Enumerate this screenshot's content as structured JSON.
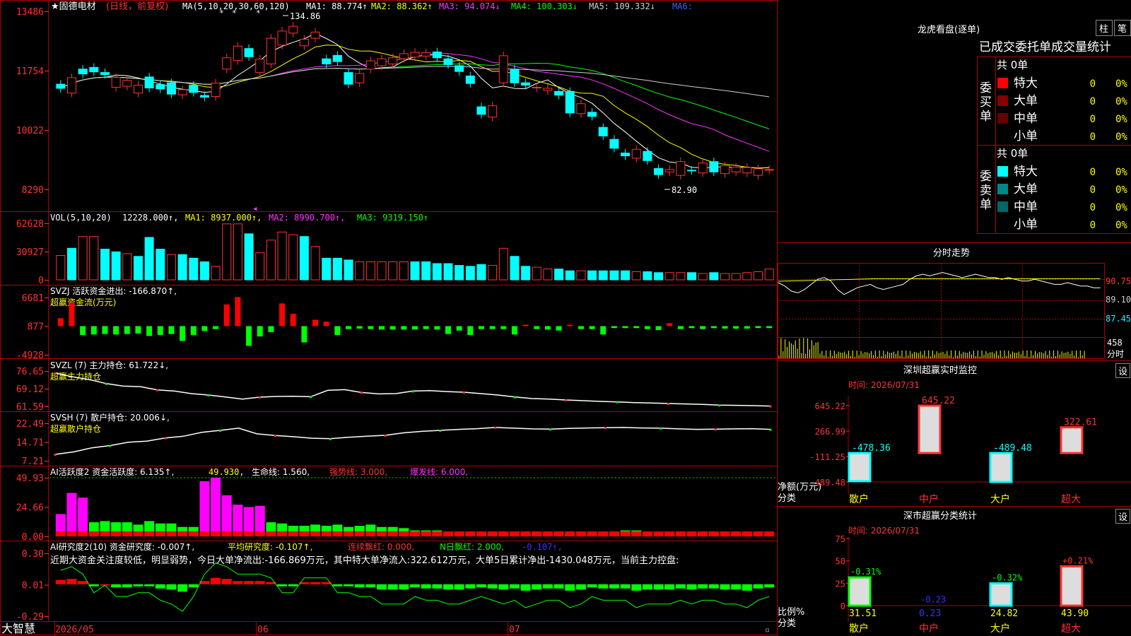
{
  "header": {
    "stock_name": "★固德电材",
    "period": "(日线，前复权)",
    "ma_label": "MA(5,10,20,30,60,120)",
    "ma": [
      {
        "label": "MA1: 88.774↑",
        "color": "#ffffff"
      },
      {
        "label": "MA2: 88.362↑",
        "color": "#ffff00"
      },
      {
        "label": "MA3: 94.074↓",
        "color": "#ff33ff"
      },
      {
        "label": "MA4: 100.303↓",
        "color": "#00ff00"
      },
      {
        "label": "MA5: 109.332↓",
        "color": "#d0d0d0"
      },
      {
        "label": "MA6:",
        "color": "#3366ff"
      }
    ],
    "high_note": "134.86",
    "low_note": "82.90"
  },
  "axes": {
    "price_ticks": [
      "13486",
      "11754",
      "10022",
      "8290"
    ],
    "vol_ticks": [
      "62628",
      "30927",
      "0"
    ],
    "svzj_ticks": [
      "6681",
      "877",
      "-4928"
    ],
    "svzl_ticks": [
      "76.65",
      "69.12",
      "61.59"
    ],
    "svsh_ticks": [
      "22.49",
      "14.71",
      "7.21"
    ],
    "ai_ticks": [
      "49.93",
      "24.66",
      "0.00"
    ],
    "ai2_ticks": [
      "0.30",
      "0.01",
      "-0.29"
    ],
    "dates": [
      "2026/05",
      "06",
      "07"
    ]
  },
  "panels": {
    "vol": {
      "title": "VOL(5,10,20)",
      "value": "12228.000↑,",
      "ma1": "MA1: 8937.000↑,",
      "ma2": "MA2: 8990.700↑,",
      "ma3": "MA3: 9319.150↑"
    },
    "svzj": {
      "title": "SVZJ  活跃资金进出: -166.870↑,",
      "subtitle": "超赢资金流(万元)"
    },
    "svzl": {
      "title": "SVZL (7) 主力持仓: 61.722↓,",
      "subtitle": "超赢主力持仓"
    },
    "svsh": {
      "title": "SVSH (7) 散户持仓: 20.006↓,",
      "subtitle": "超赢散户持仓"
    },
    "ai": {
      "title": "AI活跃度2 资金活跃度: 6.135↑,",
      "v2": "49.930,",
      "v3": "生命线: 1.560,",
      "v4": "强势线: 3.000,",
      "v5": "爆发线: 6.000,"
    },
    "ai2": {
      "title": "AI研究度2(10) 资金研究度: -0.007↑,",
      "v2": "平均研究度: -0.107↑,",
      "v3": "连续飘红: 0.000,",
      "v4": "N日飘红: 2.000,",
      "v5": "-0.107↑,",
      "comment": "近期大资金关注度较低，明显弱势，今日大单净流出:-166.869万元，其中特大单净流入:322.612万元，大单5日累计净出-1430.048万元，当前主力控盘:"
    }
  },
  "brand": "大智慧",
  "right": {
    "dragon": {
      "title": "龙虎看盘(逐单)",
      "btn1": "柱",
      "btn2": "笔",
      "subtitle": "已成交委托单成交量统计",
      "buy": {
        "side": "委买单",
        "count": "共 0单",
        "rows": [
          {
            "label": "特大",
            "value": "0",
            "pct": "0%"
          },
          {
            "label": "大单",
            "value": "0",
            "pct": "0%"
          },
          {
            "label": "中单",
            "value": "0",
            "pct": "0%"
          },
          {
            "label": "小单",
            "value": "0",
            "pct": "0%"
          }
        ]
      },
      "sell": {
        "side": "委卖单",
        "count": "共 0单",
        "rows": [
          {
            "label": "特大",
            "value": "0",
            "pct": "0%"
          },
          {
            "label": "大单",
            "value": "0",
            "pct": "0%"
          },
          {
            "label": "中单",
            "value": "0",
            "pct": "0%"
          },
          {
            "label": "小单",
            "value": "0",
            "pct": "0%"
          }
        ]
      }
    },
    "intraday": {
      "title": "分时走势",
      "p1": "90.75",
      "p2": "89.10",
      "p3": "87.45",
      "vol": "458",
      "unit": "分时"
    },
    "monitor": {
      "title": "深圳超赢实时监控",
      "btn": "设",
      "time": "时间: 2026/07/31",
      "ticks": [
        "645.22",
        "266.99",
        "-111.25",
        "-489.48"
      ],
      "ylabel1": "净额(万元)",
      "ylabel2": "分类",
      "cats": [
        "散户",
        "中户",
        "大户",
        "超大"
      ]
    },
    "stats": {
      "title": "深市超赢分类统计",
      "btn": "设",
      "time": "时间: 2026/07/31",
      "ticks": [
        "75",
        "50",
        "25",
        "0"
      ],
      "ylabel1": "比例%",
      "ylabel2": "分类",
      "cats": [
        "散户",
        "中户",
        "大户",
        "超大"
      ]
    }
  },
  "chart_data": [
    {
      "type": "candlestick",
      "title": "★固德电材 (日线，前复权)",
      "ylim": [
        82.9,
        134.86
      ],
      "ticks": [
        134.86,
        117.54,
        100.22,
        82.9
      ],
      "x": [
        "2026/05",
        "06",
        "07"
      ],
      "candles": [
        {
          "o": 113.6,
          "c": 112.4
        },
        {
          "o": 111.0,
          "c": 115.5
        },
        {
          "o": 118.0,
          "c": 116.6
        },
        {
          "o": 118.5,
          "c": 117.2
        },
        {
          "o": 117.0,
          "c": 116.4
        },
        {
          "o": 112.7,
          "c": 115.6
        },
        {
          "o": 113.0,
          "c": 114.7
        },
        {
          "o": 111.0,
          "c": 113.3
        },
        {
          "o": 115.7,
          "c": 112.5
        },
        {
          "o": 113.5,
          "c": 112.2
        },
        {
          "o": 114.0,
          "c": 110.7
        },
        {
          "o": 110.5,
          "c": 112.0
        },
        {
          "o": 113.3,
          "c": 111.2
        },
        {
          "o": 110.3,
          "c": 109.8
        },
        {
          "o": 110.0,
          "c": 113.9
        },
        {
          "o": 118.0,
          "c": 121.3
        },
        {
          "o": 120.5,
          "c": 124.7
        },
        {
          "o": 124.0,
          "c": 121.6
        },
        {
          "o": 117.0,
          "c": 120.9
        },
        {
          "o": 119.5,
          "c": 127.0
        },
        {
          "o": 125.0,
          "c": 129.1
        },
        {
          "o": 128.5,
          "c": 130.5
        },
        {
          "o": 124.8,
          "c": 126.7
        },
        {
          "o": 127.0,
          "c": 128.8
        },
        {
          "o": 121.0,
          "c": 119.5
        },
        {
          "o": 122.0,
          "c": 120.2
        },
        {
          "o": 117.0,
          "c": 113.6
        },
        {
          "o": 114.0,
          "c": 116.7
        },
        {
          "o": 118.0,
          "c": 120.4
        },
        {
          "o": 119.0,
          "c": 121.0
        },
        {
          "o": 119.5,
          "c": 121.3
        },
        {
          "o": 121.0,
          "c": 122.5
        },
        {
          "o": 121.5,
          "c": 122.9
        },
        {
          "o": 121.8,
          "c": 122.8
        },
        {
          "o": 123.0,
          "c": 121.3
        },
        {
          "o": 121.0,
          "c": 119.3
        },
        {
          "o": 119.0,
          "c": 117.3
        },
        {
          "o": 116.0,
          "c": 113.8
        },
        {
          "o": 107.0,
          "c": 104.8
        },
        {
          "o": 104.0,
          "c": 107.3
        },
        {
          "o": 114.0,
          "c": 121.9
        },
        {
          "o": 118.0,
          "c": 114.0
        },
        {
          "o": 114.0,
          "c": 113.3
        },
        {
          "o": 112.5,
          "c": 112.7
        },
        {
          "o": 111.8,
          "c": 112.4
        },
        {
          "o": 111.5,
          "c": 110.4
        },
        {
          "o": 111.5,
          "c": 105.2
        },
        {
          "o": 105.0,
          "c": 107.9
        },
        {
          "o": 105.4,
          "c": 104.2
        },
        {
          "o": 101.0,
          "c": 98.5
        },
        {
          "o": 97.5,
          "c": 94.9
        },
        {
          "o": 93.5,
          "c": 92.7
        },
        {
          "o": 92.0,
          "c": 94.6
        },
        {
          "o": 94.0,
          "c": 91.3
        },
        {
          "o": 89.0,
          "c": 87.2
        },
        {
          "o": 88.0,
          "c": 88.7
        },
        {
          "o": 87.0,
          "c": 91.0
        },
        {
          "o": 88.5,
          "c": 88.4
        },
        {
          "o": 87.7,
          "c": 90.6
        },
        {
          "o": 91.0,
          "c": 88.0
        },
        {
          "o": 87.5,
          "c": 89.8
        },
        {
          "o": 88.0,
          "c": 89.4
        },
        {
          "o": 87.7,
          "c": 89.3
        },
        {
          "o": 87.0,
          "c": 88.9
        },
        {
          "o": 88.5,
          "c": 88.7
        }
      ]
    },
    {
      "type": "bar",
      "title": "VOL(5,10,20)",
      "ylim": [
        0,
        62628
      ],
      "values": [
        27000,
        35000,
        48000,
        48000,
        34000,
        31000,
        29000,
        26000,
        47000,
        34000,
        28000,
        28000,
        24000,
        20000,
        15000,
        62000,
        62000,
        51000,
        30000,
        44000,
        53000,
        50000,
        48000,
        37000,
        24000,
        24000,
        22000,
        20000,
        20000,
        20000,
        20000,
        20000,
        20000,
        20000,
        18000,
        18000,
        16000,
        15000,
        17000,
        16000,
        35000,
        26000,
        15000,
        14000,
        12000,
        12000,
        10000,
        10000,
        10000,
        10000,
        10000,
        10000,
        9000,
        9000,
        8000,
        8000,
        8000,
        8000,
        7000,
        8000,
        7000,
        7000,
        8000,
        9000,
        12000
      ],
      "up": [
        1,
        0,
        1,
        1,
        0,
        0,
        1,
        0,
        0,
        0,
        1,
        0,
        0,
        0,
        1,
        1,
        1,
        0,
        1,
        1,
        1,
        1,
        0,
        1,
        0,
        0,
        0,
        1,
        1,
        1,
        1,
        1,
        0,
        0,
        0,
        0,
        0,
        0,
        0,
        1,
        1,
        0,
        0,
        1,
        1,
        0,
        0,
        1,
        0,
        0,
        0,
        0,
        1,
        0,
        0,
        1,
        1,
        0,
        1,
        0,
        1,
        1,
        1,
        1,
        1
      ]
    },
    {
      "type": "bar",
      "title": "SVZJ",
      "ylim": [
        -4928,
        6681
      ],
      "values": [
        1600,
        4800,
        -1800,
        -1700,
        -1600,
        -1700,
        -1600,
        -1500,
        -2000,
        -1800,
        -1600,
        -3000,
        -1800,
        -1000,
        -600,
        4400,
        5900,
        -4000,
        -2100,
        -1200,
        4600,
        2500,
        -3300,
        1300,
        900,
        -1800,
        -600,
        -500,
        -600,
        -700,
        -700,
        -700,
        -700,
        -600,
        -700,
        -1600,
        -900,
        -1800,
        -600,
        -600,
        -600,
        -1700,
        300,
        -600,
        -700,
        -900,
        300,
        -600,
        -600,
        -1700,
        -400,
        -400,
        -400,
        -600,
        -800,
        600,
        -600,
        -400,
        -600,
        -400,
        -500,
        -500,
        -500,
        -400,
        -400
      ]
    },
    {
      "type": "line",
      "title": "SVZL (7)",
      "ylim": [
        61.59,
        76.65
      ],
      "values": [
        75.8,
        74.2,
        73.0,
        71.3,
        70.2,
        70.0,
        68.6,
        68.1,
        67.0,
        66.4,
        65.6,
        64.7,
        65.5,
        65.8,
        65.9,
        65.7,
        68.4,
        68.7,
        67.5,
        66.9,
        67.0,
        68.1,
        68.3,
        67.9,
        67.6,
        67.0,
        66.4,
        65.6,
        64.9,
        64.7,
        64.3,
        64.0,
        63.7,
        63.5,
        63.2,
        63.0,
        62.8,
        62.6,
        62.4,
        62.1,
        62.0,
        61.9,
        61.72
      ]
    },
    {
      "type": "line",
      "title": "SVSH (7)",
      "ylim": [
        7.21,
        22.49
      ],
      "values": [
        9.8,
        10.8,
        12.5,
        13.4,
        14.8,
        15.2,
        16.5,
        17.2,
        18.8,
        19.6,
        20.5,
        18.2,
        17.5,
        17.0,
        16.4,
        16.2,
        16.8,
        17.2,
        17.6,
        18.6,
        19.2,
        19.6,
        20.0,
        20.3,
        20.8,
        20.5,
        20.2,
        20.1,
        20.4,
        20.6,
        20.7,
        20.8,
        20.6,
        20.5,
        20.2,
        20.0,
        20.1,
        20.2,
        20.3,
        20.006
      ]
    },
    {
      "type": "bar",
      "title": "AI活跃度2",
      "ylim": [
        0,
        49.93
      ],
      "values": [
        19,
        37,
        33,
        12,
        13,
        12,
        12,
        10,
        13,
        11,
        11,
        8,
        8,
        47,
        50,
        35,
        27,
        25,
        26,
        12,
        11,
        9,
        9,
        10,
        9,
        10,
        8,
        9,
        10,
        8,
        8,
        7,
        5,
        5,
        5,
        4,
        4,
        4,
        4,
        3,
        3,
        4,
        3,
        4,
        3,
        3,
        2,
        2,
        3,
        3,
        4,
        5,
        5,
        4,
        4,
        4,
        3,
        3,
        3,
        3,
        3,
        3,
        3,
        3,
        3
      ],
      "magenta": [
        1,
        1,
        1,
        0,
        0,
        0,
        0,
        0,
        0,
        0,
        0,
        0,
        0,
        1,
        1,
        1,
        1,
        1,
        1,
        0,
        0,
        0,
        0,
        0,
        0,
        0,
        0,
        0,
        0,
        0,
        0,
        0,
        0,
        0,
        0,
        0,
        0,
        0,
        0,
        0,
        0,
        0,
        0,
        0,
        0,
        0,
        0,
        0,
        0,
        0,
        0,
        0,
        0,
        0,
        0,
        0,
        0,
        0,
        0,
        0,
        0,
        0,
        0,
        0,
        0
      ]
    },
    {
      "type": "bar",
      "title": "AI研究度2(10)",
      "ylim": [
        -0.29,
        0.3
      ],
      "values": [
        0.04,
        0.05,
        0.03,
        -0.02,
        0.0,
        -0.03,
        -0.03,
        -0.02,
        -0.02,
        -0.04,
        -0.05,
        -0.07,
        -0.03,
        0.03,
        0.06,
        0.05,
        0.03,
        0.03,
        0.03,
        0.02,
        -0.02,
        -0.02,
        0.02,
        0.02,
        0.02,
        -0.02,
        -0.02,
        -0.03,
        -0.03,
        -0.05,
        -0.05,
        -0.05,
        -0.03,
        -0.04,
        -0.04,
        -0.05,
        -0.05,
        -0.04,
        -0.03,
        -0.04,
        -0.05,
        -0.04,
        -0.06,
        -0.05,
        -0.04,
        -0.04,
        -0.06,
        -0.05,
        -0.03,
        -0.04,
        -0.04,
        -0.04,
        -0.06,
        -0.05,
        -0.05,
        -0.05,
        -0.04,
        -0.05,
        -0.04,
        -0.04,
        -0.05,
        -0.05,
        -0.06,
        -0.04,
        -0.03
      ]
    },
    {
      "type": "bar",
      "title": "深圳超赢实时监控",
      "categories": [
        "散户",
        "中户",
        "大户",
        "超大"
      ],
      "values": [
        -478.36,
        645.22,
        -489.48,
        322.61
      ]
    },
    {
      "type": "bar",
      "title": "深市超赢分类统计",
      "categories": [
        "散户",
        "中户",
        "大户",
        "超大"
      ],
      "values": [
        31.51,
        0.23,
        24.82,
        43.9
      ],
      "changes": [
        "-0.31%",
        "-0.23",
        "-0.32%",
        "+0.21%"
      ]
    }
  ]
}
